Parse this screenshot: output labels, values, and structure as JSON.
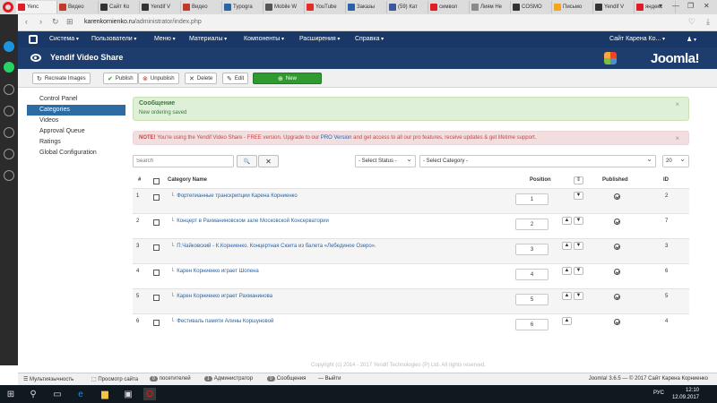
{
  "browser": {
    "tabs": [
      {
        "label": "Yenc",
        "color": "#e01c24",
        "active": true
      },
      {
        "label": "Видео",
        "color": "#c0392b"
      },
      {
        "label": "Сайт Ко",
        "color": "#333"
      },
      {
        "label": "Yendif V",
        "color": "#333"
      },
      {
        "label": "Видео",
        "color": "#c0392b"
      },
      {
        "label": "Typogra",
        "color": "#2a64a6"
      },
      {
        "label": "Mobile W",
        "color": "#555"
      },
      {
        "label": "YouTube",
        "color": "#e52d27"
      },
      {
        "label": "Заказы",
        "color": "#2a64a6"
      },
      {
        "label": "(59) Кат",
        "color": "#3b5998"
      },
      {
        "label": "символ",
        "color": "#e01c24"
      },
      {
        "label": "Лиям Не",
        "color": "#8a8a8a"
      },
      {
        "label": "COSMO",
        "color": "#333"
      },
      {
        "label": "Письмо",
        "color": "#f4a41d"
      },
      {
        "label": "Yendif V",
        "color": "#333"
      },
      {
        "label": "яндекс",
        "color": "#e01c24"
      }
    ],
    "url_domain": "karenkornienko.ru",
    "url_path": "/administrator/index.php",
    "window_controls": [
      "▾",
      "—",
      "❐",
      "✕"
    ]
  },
  "topmenu": {
    "items": [
      "Система",
      "Пользователи",
      "Меню",
      "Материалы",
      "Компоненты",
      "Расширения",
      "Справка"
    ],
    "site_link": "Сайт Карена Ко...",
    "user_menu": "♟"
  },
  "header": {
    "title": "Yendif Video Share",
    "brand": "Joomla!"
  },
  "toolbar": {
    "recreate": "Recreate Images",
    "publish": "Publish",
    "unpublish": "Unpublish",
    "delete": "Delete",
    "edit": "Edit",
    "new": "New"
  },
  "submenu": {
    "items": [
      "Control Panel",
      "Categories",
      "Videos",
      "Approval Queue",
      "Ratings",
      "Global Configuration"
    ]
  },
  "messages": {
    "success_title": "Сообщение",
    "success_text": "New ordering saved",
    "error_label": "NOTE!",
    "error_text_1": " You're using the Yendif Video Share - FREE version. Upgrade to our ",
    "error_link": "PRO Version",
    "error_text_2": " and get access to all our pro features, receive updates & get lifetime support.",
    "close": "×"
  },
  "filters": {
    "search_placeholder": "Search",
    "search_icon": "🔍",
    "clear_icon": "✕",
    "status": "- Select Status -",
    "category": "- Select Category -",
    "limit": "20"
  },
  "table": {
    "headers": {
      "num": "#",
      "name": "Category Name",
      "position": "Position",
      "published": "Published",
      "id": "ID"
    },
    "rows": [
      {
        "num": "1",
        "name": "Фортепианные транскрипции Карена Корниенко",
        "pos": "1",
        "id": "2"
      },
      {
        "num": "2",
        "name": "Концерт в Рахманиновском зале Московской Консерватории",
        "pos": "2",
        "id": "7"
      },
      {
        "num": "3",
        "name": "П.Чайковский - К.Корниенко. Концертная Сюита из балета «Лебединое Озеро».",
        "pos": "3",
        "id": "3"
      },
      {
        "num": "4",
        "name": "Карен Корниенко играет Шопена",
        "pos": "4",
        "id": "6"
      },
      {
        "num": "5",
        "name": "Карен Корниенко играет Рахманинова",
        "pos": "5",
        "id": "5"
      },
      {
        "num": "6",
        "name": "Фестиваль памяти Алины Коршуновой",
        "pos": "6",
        "id": "4"
      }
    ]
  },
  "footer": {
    "copyright": "Copyright (c) 2014 - 2017 Yendif Technologies (P) Ltd. All rights reserved."
  },
  "statusbar": {
    "multilang": "Мультиязычность",
    "preview": "Просмотр сайта",
    "visitors_count": "0",
    "visitors": "посетителей",
    "admins_count": "1",
    "admins": "Администратор",
    "messages_count": "0",
    "messages": "Сообщения",
    "logout": "Выйти",
    "version": "Joomla! 3.6.5 — © 2017 Сайт Карена Корниенко"
  },
  "taskbar": {
    "lang": "РУС",
    "time": "12:10",
    "date": "12.09.2017"
  }
}
